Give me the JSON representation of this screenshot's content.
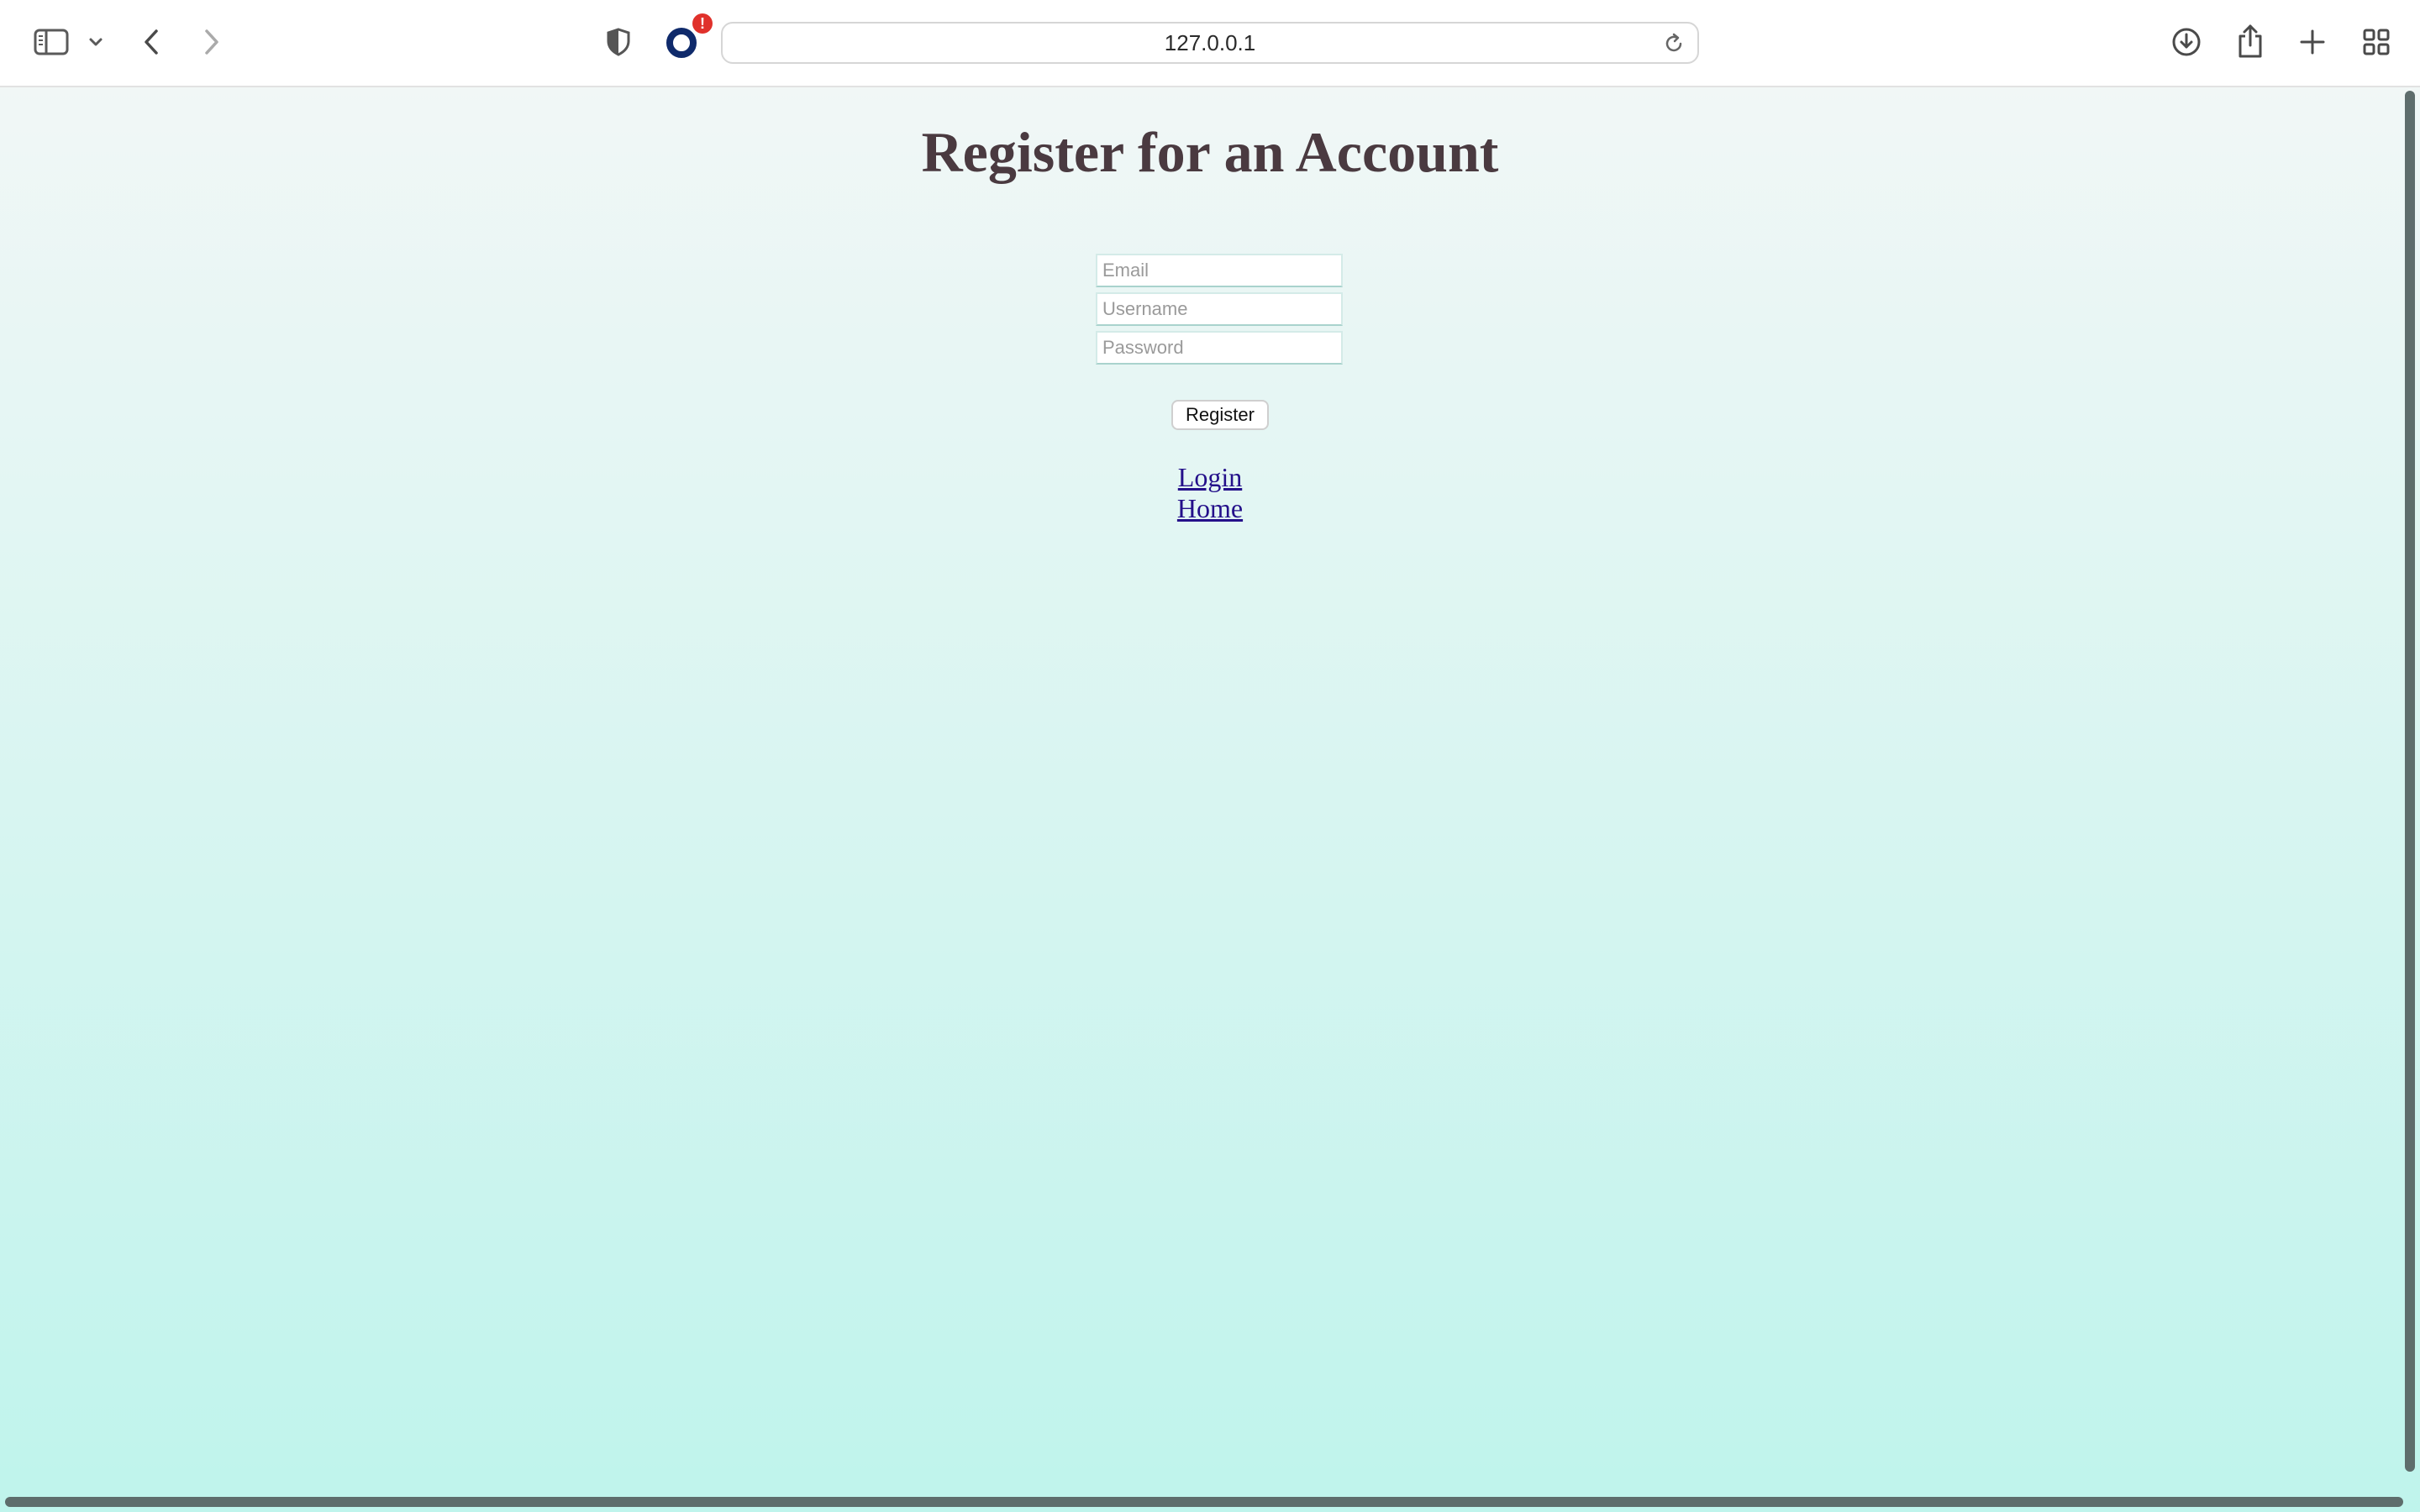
{
  "browser": {
    "address": "127.0.0.1",
    "extension_badge": "!",
    "icons": {
      "sidebar": "sidebar-icon",
      "sidebar_menu": "chevron-down-icon",
      "back": "back-arrow-icon",
      "forward": "forward-arrow-icon",
      "privacy": "shield-icon",
      "extension": "extension-ring-icon",
      "reload": "reload-icon",
      "download": "download-icon",
      "share": "share-icon",
      "new_tab": "plus-icon",
      "tab_overview": "tab-grid-icon"
    }
  },
  "page": {
    "title": "Register for an Account",
    "form": {
      "email_placeholder": "Email",
      "username_placeholder": "Username",
      "password_placeholder": "Password",
      "email_value": "",
      "username_value": "",
      "password_value": "",
      "submit_label": "Register"
    },
    "links": {
      "login": "Login",
      "home": "Home"
    }
  },
  "colors": {
    "title": "#4a3a40",
    "link": "#24108a",
    "background_top": "#f1f7f6",
    "background_bottom": "#bff4ec",
    "extension_badge": "#e0312b",
    "extension_ring": "#0f2a6b"
  }
}
